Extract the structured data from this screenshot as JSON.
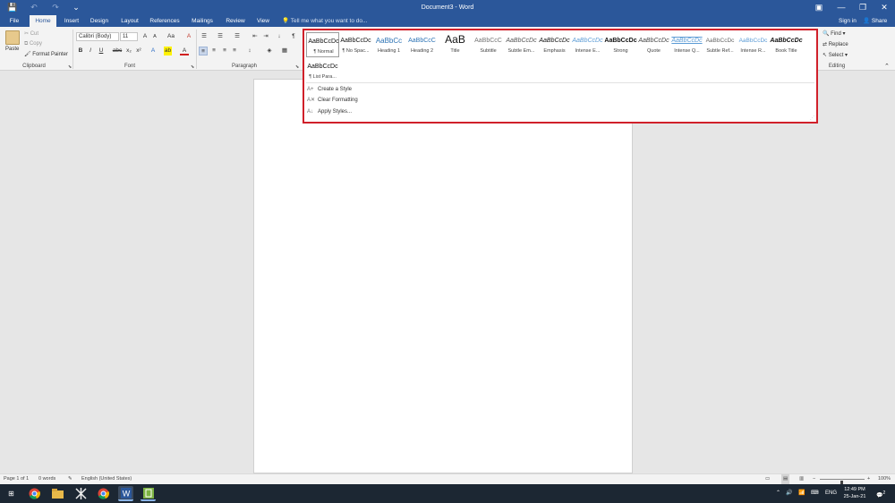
{
  "titlebar": {
    "title": "Document3 - Word",
    "save_icon": "💾",
    "undo_icon": "↶",
    "redo_icon": "↷",
    "customize_icon": "⌄",
    "ribbon_display_icon": "▣",
    "minimize_icon": "—",
    "restore_icon": "❐",
    "close_icon": "✕"
  },
  "tabs": [
    {
      "label": "File"
    },
    {
      "label": "Home"
    },
    {
      "label": "Insert"
    },
    {
      "label": "Design"
    },
    {
      "label": "Layout"
    },
    {
      "label": "References"
    },
    {
      "label": "Mailings"
    },
    {
      "label": "Review"
    },
    {
      "label": "View"
    }
  ],
  "tellme": {
    "icon": "💡",
    "placeholder": "Tell me what you want to do..."
  },
  "account": {
    "signin": "Sign in",
    "share": "Share",
    "share_icon": "👤"
  },
  "clipboard": {
    "paste": "Paste",
    "cut": "Cut",
    "copy": "Copy",
    "format_painter": "Format Painter",
    "label": "Clipboard"
  },
  "font": {
    "name": "Calibri (Body)",
    "size": "11",
    "grow": "A",
    "shrink": "A",
    "case": "Aa",
    "clear": "A",
    "bold": "B",
    "italic": "I",
    "underline": "U",
    "strike": "abc",
    "subscript": "x₂",
    "superscript": "x²",
    "effects": "A",
    "highlight": "ab",
    "color": "A",
    "label": "Font"
  },
  "paragraph": {
    "bullets": "☰",
    "numbering": "☰",
    "multilevel": "☰",
    "decrease_indent": "⇤",
    "increase_indent": "⇥",
    "sort": "↓",
    "show_marks": "¶",
    "align_left": "≡",
    "center": "≡",
    "align_right": "≡",
    "justify": "≡",
    "line_spacing": "↕",
    "shading": "◈",
    "borders": "▦",
    "label": "Paragraph"
  },
  "styles": [
    {
      "preview": "AaBbCcDc",
      "name": "¶ Normal"
    },
    {
      "preview": "AaBbCcDc",
      "name": "¶ No Spac..."
    },
    {
      "preview": "AaBbCc",
      "name": "Heading 1"
    },
    {
      "preview": "AaBbCcC",
      "name": "Heading 2"
    },
    {
      "preview": "AaB",
      "name": "Title"
    },
    {
      "preview": "AaBbCcC",
      "name": "Subtitle"
    },
    {
      "preview": "AaBbCcDc",
      "name": "Subtle Em..."
    },
    {
      "preview": "AaBbCcDc",
      "name": "Emphasis"
    },
    {
      "preview": "AaBbCcDc",
      "name": "Intense E..."
    },
    {
      "preview": "AaBbCcDc",
      "name": "Strong"
    },
    {
      "preview": "AaBbCcDc",
      "name": "Quote"
    },
    {
      "preview": "AaBbCcDc",
      "name": "Intense Q..."
    },
    {
      "preview": "AaBbCcDc",
      "name": "Subtle Ref..."
    },
    {
      "preview": "AaBbCcDc",
      "name": "Intense R..."
    },
    {
      "preview": "AaBbCcDc",
      "name": "Book Title"
    },
    {
      "preview": "AaBbCcDc",
      "name": "¶ List Para..."
    }
  ],
  "style_commands": {
    "create": "Create a Style",
    "create_icon": "A+",
    "clear": "Clear Formatting",
    "clear_icon": "A✕",
    "apply": "Apply Styles...",
    "apply_icon": "A↓",
    "resize_icon": "⋰"
  },
  "editing": {
    "find": "Find",
    "find_icon": "🔍",
    "replace": "Replace",
    "replace_icon": "⇄",
    "select": "Select",
    "select_icon": "↖",
    "label": "Editing",
    "collapse_icon": "⌃"
  },
  "status": {
    "page": "Page 1 of 1",
    "words": "0 words",
    "proof_icon": "✎",
    "language": "English (United States)",
    "zoom": "100%",
    "zoom_minus": "−",
    "zoom_plus": "+",
    "read_mode_icon": "▭",
    "print_layout_icon": "▤",
    "web_layout_icon": "▥"
  },
  "taskbar": {
    "start_icon": "⊞",
    "tray_expand": "⌃",
    "volume_icon": "🔊",
    "network_icon": "📶",
    "keyboard_icon": "⌨",
    "lang": "ENG",
    "time": "12:49 PM",
    "date": "25-Jan-21",
    "notifications_icon": "💬",
    "notifications_count": "2"
  }
}
